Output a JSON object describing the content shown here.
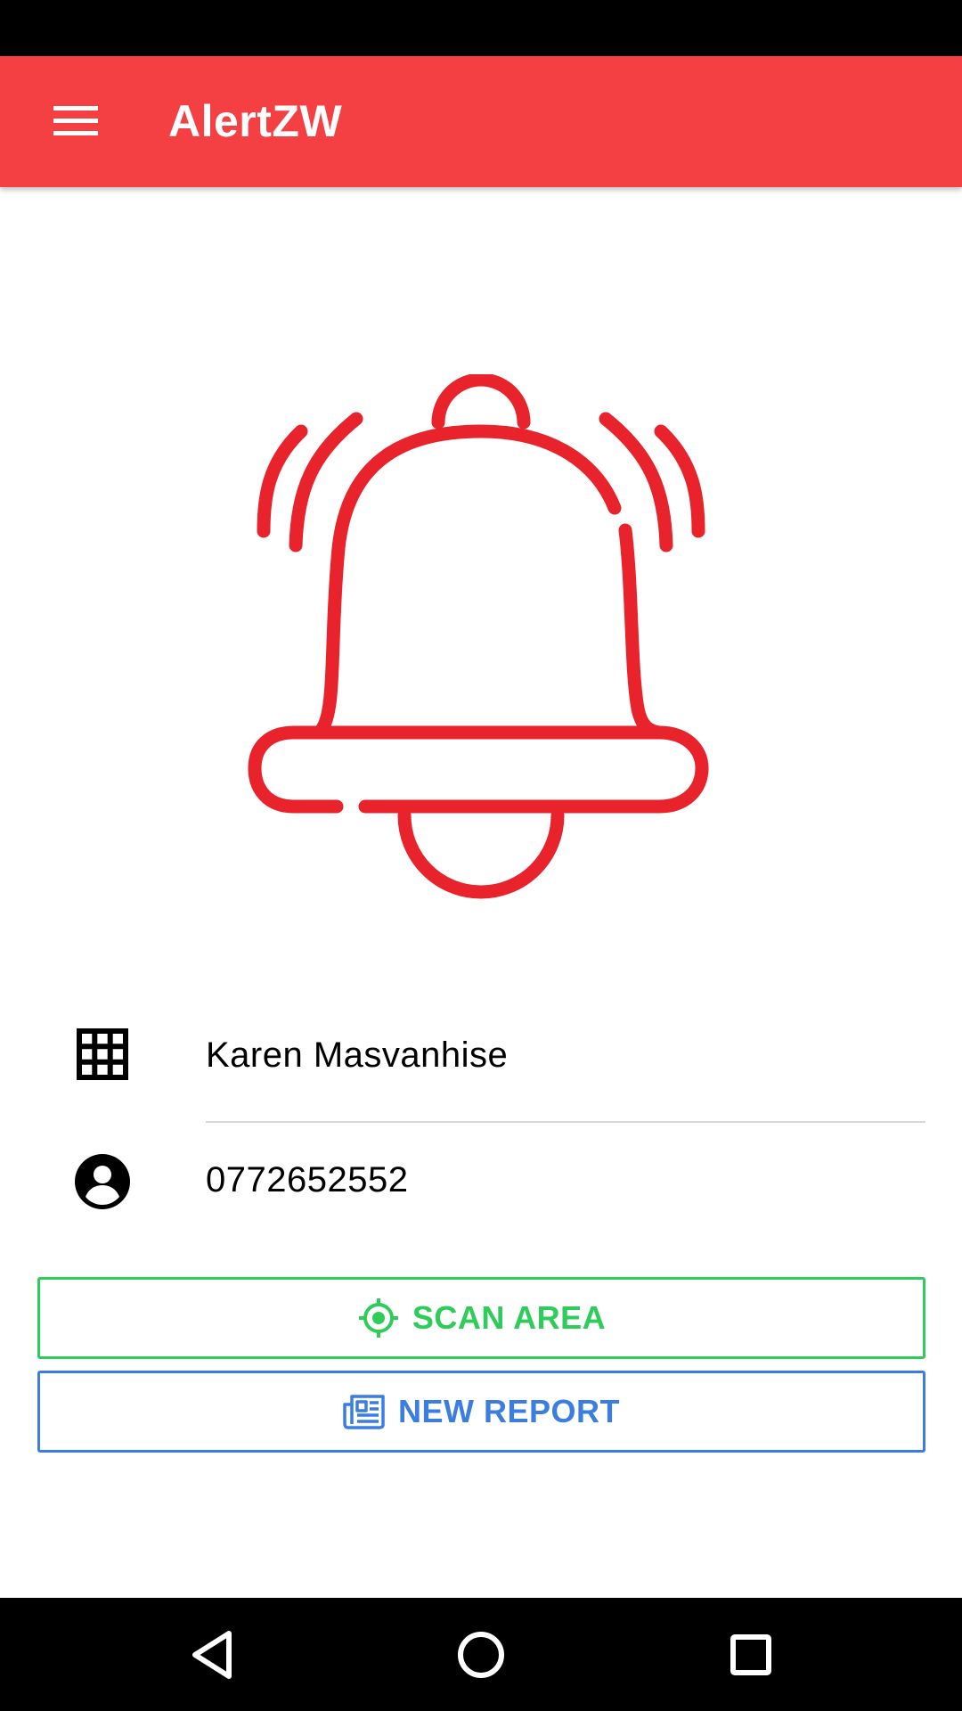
{
  "app": {
    "title": "AlertZW"
  },
  "colors": {
    "app_bar": "#F44043",
    "bell": "#E8232B",
    "scan_accent": "#2ECC5A",
    "report_accent": "#3B7DE0"
  },
  "icons": {
    "menu": "menu-icon",
    "hero": "bell-ringing-icon",
    "name_row": "grid-icon",
    "phone_row": "account-circle-icon",
    "scan": "crosshairs-gps-icon",
    "report": "newspaper-icon",
    "nav_back": "back-triangle-icon",
    "nav_home": "home-circle-icon",
    "nav_recents": "recents-square-icon"
  },
  "profile": {
    "name": "Karen Masvanhise",
    "phone": "0772652552"
  },
  "actions": {
    "scan_label": "SCAN AREA",
    "report_label": "NEW REPORT"
  }
}
